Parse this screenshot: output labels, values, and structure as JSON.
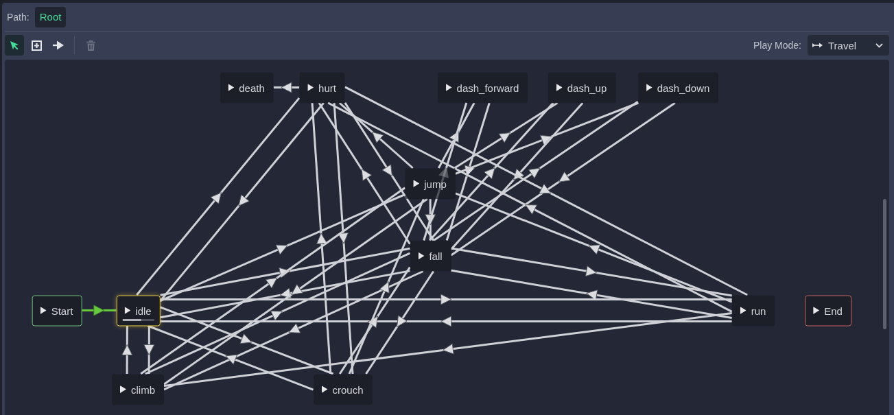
{
  "path_bar": {
    "label": "Path:",
    "crumbs": [
      {
        "label": "Root",
        "selected": true
      }
    ]
  },
  "toolbar": {
    "tools": [
      {
        "kind": "select",
        "selected": true
      },
      {
        "kind": "create",
        "selected": false
      },
      {
        "kind": "connect",
        "selected": false
      }
    ],
    "delete_tool": {
      "disabled": true
    },
    "play_mode": {
      "label": "Play Mode:",
      "value": "Travel"
    }
  },
  "state_machine": {
    "nodes": [
      {
        "name": "death",
        "kind": "state",
        "playing": false
      },
      {
        "name": "hurt",
        "kind": "state",
        "playing": false
      },
      {
        "name": "dash_forward",
        "kind": "state",
        "playing": false
      },
      {
        "name": "dash_up",
        "kind": "state",
        "playing": false
      },
      {
        "name": "dash_down",
        "kind": "state",
        "playing": false
      },
      {
        "name": "jump",
        "kind": "state",
        "playing": false
      },
      {
        "name": "fall",
        "kind": "state",
        "playing": false
      },
      {
        "name": "Start",
        "kind": "start",
        "playing": false
      },
      {
        "name": "idle",
        "kind": "state",
        "playing": true,
        "level": 0.6
      },
      {
        "name": "run",
        "kind": "state",
        "playing": false
      },
      {
        "name": "End",
        "kind": "end",
        "playing": false
      },
      {
        "name": "climb",
        "kind": "state",
        "playing": false
      },
      {
        "name": "crouch",
        "kind": "state",
        "playing": false
      }
    ],
    "transitions": [
      {
        "active": true
      },
      {
        "active": false
      },
      {
        "active": false
      },
      {
        "active": false
      },
      {
        "active": false
      },
      {
        "active": false
      },
      {
        "active": false
      },
      {
        "active": false
      },
      {
        "active": false
      },
      {
        "active": false
      },
      {
        "active": false
      },
      {
        "active": false
      },
      {
        "active": false
      },
      {
        "active": false
      },
      {
        "active": false
      },
      {
        "active": false
      },
      {
        "active": false
      },
      {
        "active": false
      },
      {
        "active": false
      },
      {
        "active": false
      },
      {
        "active": false
      },
      {
        "active": false
      },
      {
        "active": false
      },
      {
        "active": false
      },
      {
        "active": false
      },
      {
        "active": false
      },
      {
        "active": false
      },
      {
        "active": false
      },
      {
        "active": false
      },
      {
        "active": false
      },
      {
        "active": false
      },
      {
        "active": false
      },
      {
        "active": false
      },
      {
        "active": false
      },
      {
        "active": false
      },
      {
        "active": false
      },
      {
        "active": false
      },
      {
        "active": false
      },
      {
        "active": false
      },
      {
        "active": false
      },
      {
        "active": false
      }
    ]
  }
}
